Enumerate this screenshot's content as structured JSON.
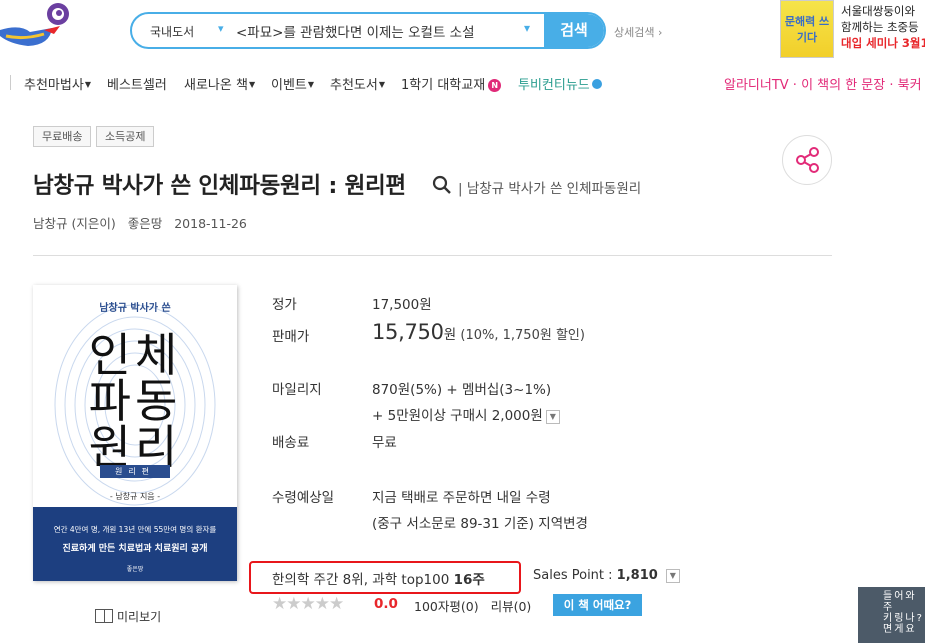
{
  "header": {
    "search": {
      "category": "국내도서",
      "query": "<파묘>를 관람했다면 이제는 오컬트 소설",
      "button": "검색",
      "detail_link": "상세검색"
    },
    "ad": {
      "book_title": "문해력 쓰기다",
      "line1": "서울대쌍둥이와",
      "line2": "함께하는 초중등",
      "line3": "대입 세미나 3월1"
    }
  },
  "nav": {
    "items": [
      {
        "label": "추천마법사"
      },
      {
        "label": "베스트셀러"
      },
      {
        "label": "새로나온 책"
      },
      {
        "label": "이벤트"
      },
      {
        "label": "추천도서"
      },
      {
        "label": "1학기 대학교재",
        "badge": "N"
      },
      {
        "label": "투비컨티뉴드"
      }
    ],
    "right": "알라디너TV · 이 책의 한 문장 · 북커"
  },
  "tags": [
    "무료배송",
    "소득공제"
  ],
  "book": {
    "title": "남창규 박사가 쓴 인체파동원리 : 원리편",
    "series": "| 남창규 박사가 쓴 인체파동원리",
    "author": "남창규 (지은이)",
    "publisher": "좋은땅",
    "date": "2018-11-26",
    "cover": {
      "top": "남창규 박사가 쓴",
      "line1": "인체",
      "line2": "파동",
      "line3": "원리",
      "sub": "원리편",
      "author": "- 남창규 지음 -",
      "bottom1": "연간 4만여 명, 개원 13년 만에 55만여 명의 환자를",
      "bottom2": "진료하게 만든 치료법과 치료원리 공개",
      "publisher": "좋은땅"
    },
    "preview": "미리보기"
  },
  "info": {
    "list_price_label": "정가",
    "list_price": "17,500원",
    "sale_price_label": "판매가",
    "sale_price": "15,750",
    "sale_won": "원",
    "sale_note": "(10%, 1,750원 할인)",
    "mileage_label": "마일리지",
    "mileage_line1": "870원(5%) + 멤버십(3~1%)",
    "mileage_line2": "+ 5만원이상 구매시 2,000원",
    "shipping_label": "배송료",
    "shipping": "무료",
    "delivery_label": "수령예상일",
    "delivery_line1": "지금 택배로 주문하면 내일 수령",
    "delivery_line2": "(중구 서소문로 89-31 기준) 지역변경"
  },
  "rank": {
    "text": "한의학 주간 8위, 과학 top100",
    "weeks": "16주",
    "sales_label": "Sales Point :",
    "sales_value": "1,810"
  },
  "rating": {
    "score": "0.0",
    "reviews100": "100자평(0)",
    "reviews": "리뷰(0)",
    "ask": "이 책 어때요?"
  },
  "qr": {
    "col1": "들어와주",
    "col2": "키링나?",
    "col3": "면게요"
  },
  "colors": {
    "accent": "#48aee7",
    "badge_red": "#e8161b",
    "pink": "#e22a78",
    "teal": "#2a9d8f"
  }
}
